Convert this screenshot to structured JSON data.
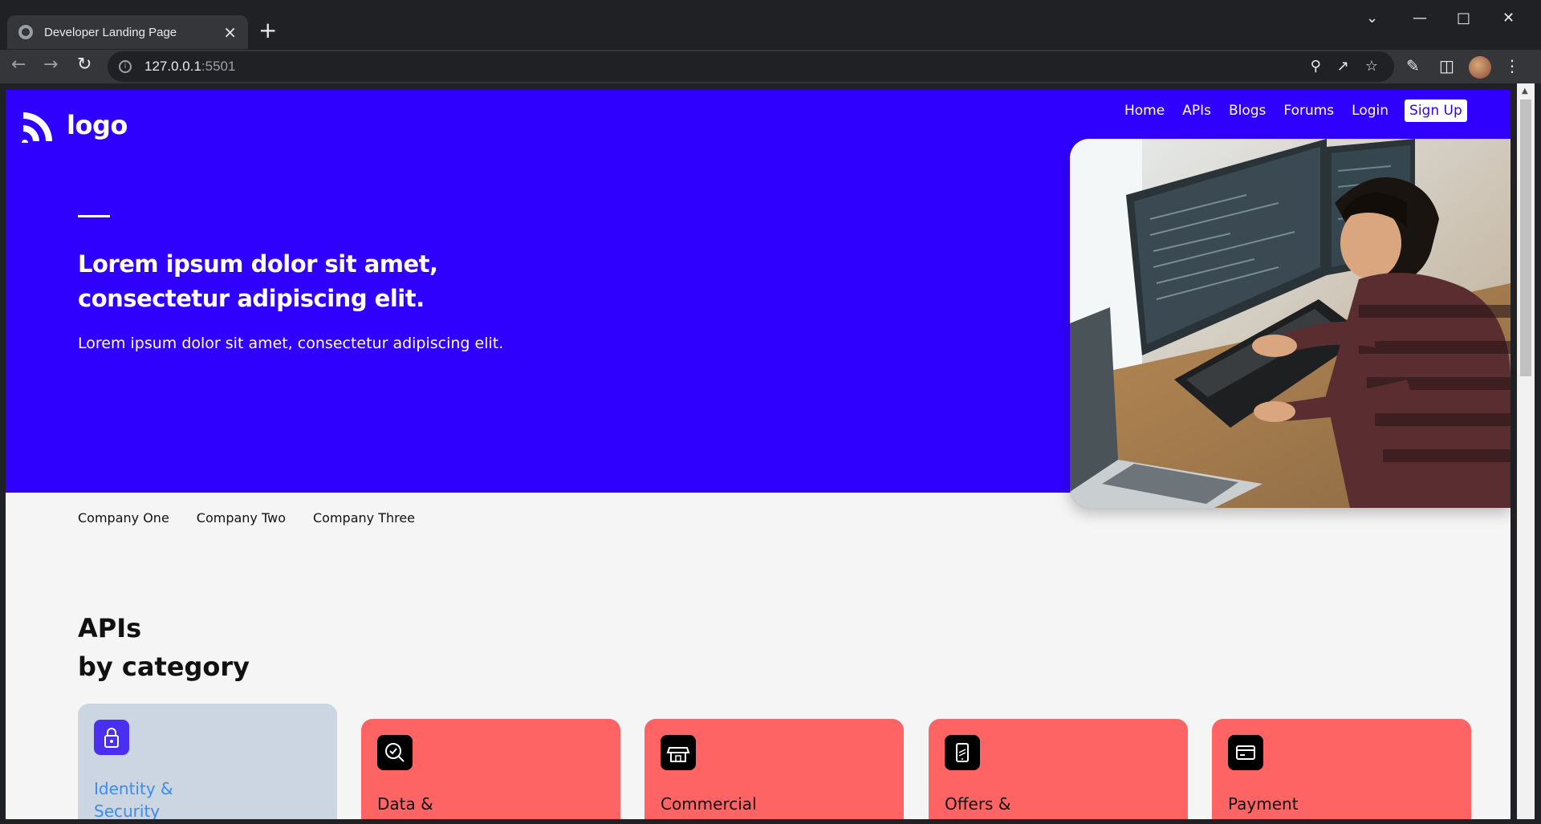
{
  "browser": {
    "tab_title": "Developer Landing Page",
    "tab_close": "×",
    "new_tab": "+",
    "url_host": "127.0.0.1",
    "url_port": ":5501"
  },
  "site": {
    "logo_text": "logo",
    "nav": [
      "Home",
      "APIs",
      "Blogs",
      "Forums",
      "Login"
    ],
    "signup_label": "Sign Up"
  },
  "hero": {
    "title": "Lorem ipsum dolor sit amet, consectetur adipiscing elit.",
    "subtitle": "Lorem ipsum dolor sit amet, consectetur adipiscing elit."
  },
  "companies": [
    "Company One",
    "Company Two",
    "Company Three"
  ],
  "apis_section": {
    "title_line1": "APIs",
    "title_line2": "by category"
  },
  "categories": [
    {
      "label_line1": "Identity &",
      "label_line2": "Security",
      "icon": "lock-icon",
      "active": true
    },
    {
      "label_line1": "Data &",
      "label_line2": "",
      "icon": "magnifier-check-icon",
      "active": false
    },
    {
      "label_line1": "Commercial",
      "label_line2": "",
      "icon": "storefront-icon",
      "active": false
    },
    {
      "label_line1": "Offers &",
      "label_line2": "",
      "icon": "phone-offer-icon",
      "active": false
    },
    {
      "label_line1": "Payment",
      "label_line2": "",
      "icon": "credit-card-icon",
      "active": false
    }
  ],
  "colors": {
    "brand_blue": "#3000ff",
    "card_red": "#ff6464",
    "card_active_bg": "#cbd6e2",
    "active_icon_bg": "#4b2ff0",
    "active_label": "#3b8cf0"
  }
}
